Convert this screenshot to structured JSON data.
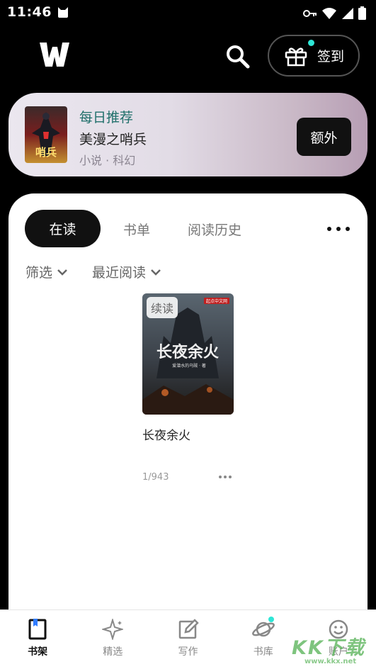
{
  "status_bar": {
    "time": "11:46"
  },
  "header": {
    "checkin_label": "签到"
  },
  "daily_recommend": {
    "tag": "每日推荐",
    "title": "美漫之哨兵",
    "meta": "小说 · 科幻",
    "button_label": "额外",
    "cover_text": "哨兵"
  },
  "shelf": {
    "tabs": [
      "在读",
      "书单",
      "阅读历史"
    ],
    "filters": [
      "筛选",
      "最近阅读"
    ],
    "book": {
      "badge": "续读",
      "title": "长夜余火",
      "cover_title": "长夜余火",
      "cover_author": "爱潜水的乌贼 · 著",
      "cover_publisher": "起点中文网",
      "progress": "1/943"
    }
  },
  "bottom_nav": [
    {
      "label": "书架",
      "icon": "bookshelf-icon",
      "active": true
    },
    {
      "label": "精选",
      "icon": "sparkle-icon",
      "active": false
    },
    {
      "label": "写作",
      "icon": "pencil-icon",
      "active": false
    },
    {
      "label": "书库",
      "icon": "planet-icon",
      "active": false
    },
    {
      "label": "账户",
      "icon": "smile-icon",
      "active": false
    }
  ],
  "watermark": {
    "text": "KK下载",
    "url": "www.kkx.net"
  },
  "colors": {
    "accent_dot": "#2ee6d6",
    "daily_tag": "#1f6f6a"
  }
}
